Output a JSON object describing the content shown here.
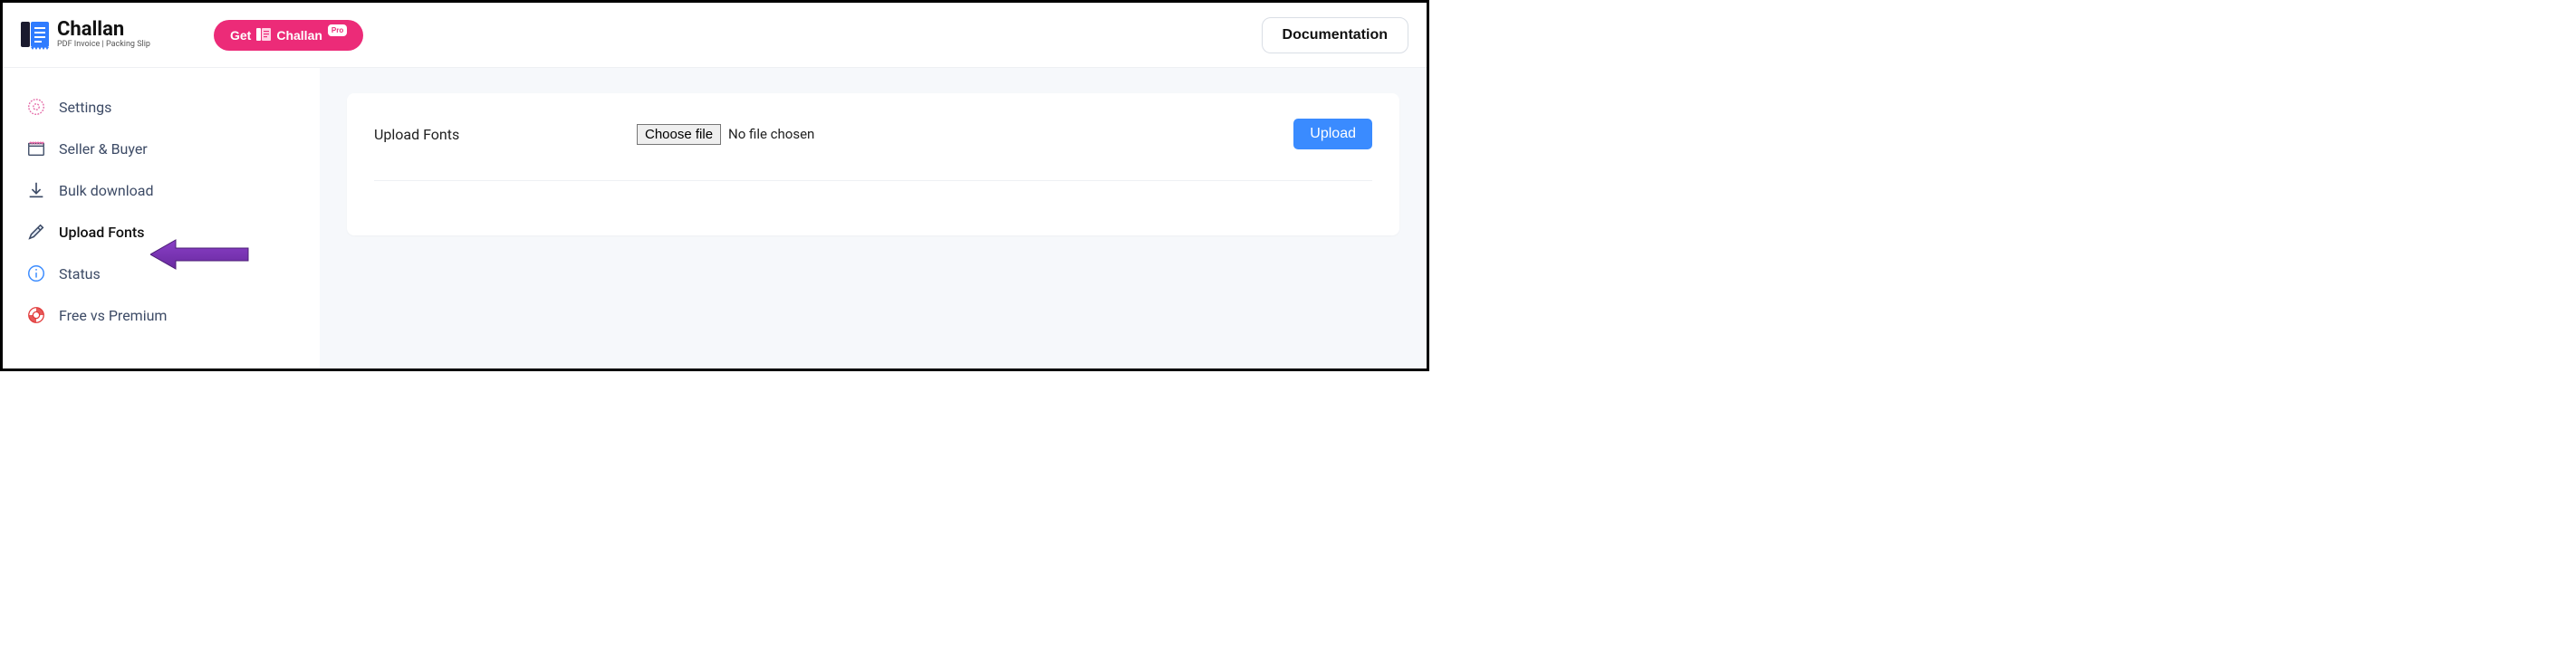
{
  "header": {
    "brand_name": "Challan",
    "brand_tag": "PDF Invoice | Packing Slip",
    "pro_get": "Get",
    "pro_name": "Challan",
    "pro_pill": "Pro",
    "doc_button": "Documentation"
  },
  "sidebar": {
    "items": [
      {
        "label": "Settings",
        "icon": "gear-icon"
      },
      {
        "label": "Seller & Buyer",
        "icon": "store-icon"
      },
      {
        "label": "Bulk download",
        "icon": "download-icon"
      },
      {
        "label": "Upload Fonts",
        "icon": "pen-icon",
        "active": true
      },
      {
        "label": "Status",
        "icon": "info-icon"
      },
      {
        "label": "Free vs Premium",
        "icon": "lifebuoy-icon"
      }
    ]
  },
  "main": {
    "row_label": "Upload Fonts",
    "choose_file": "Choose file",
    "no_file": "No file chosen",
    "upload": "Upload"
  }
}
